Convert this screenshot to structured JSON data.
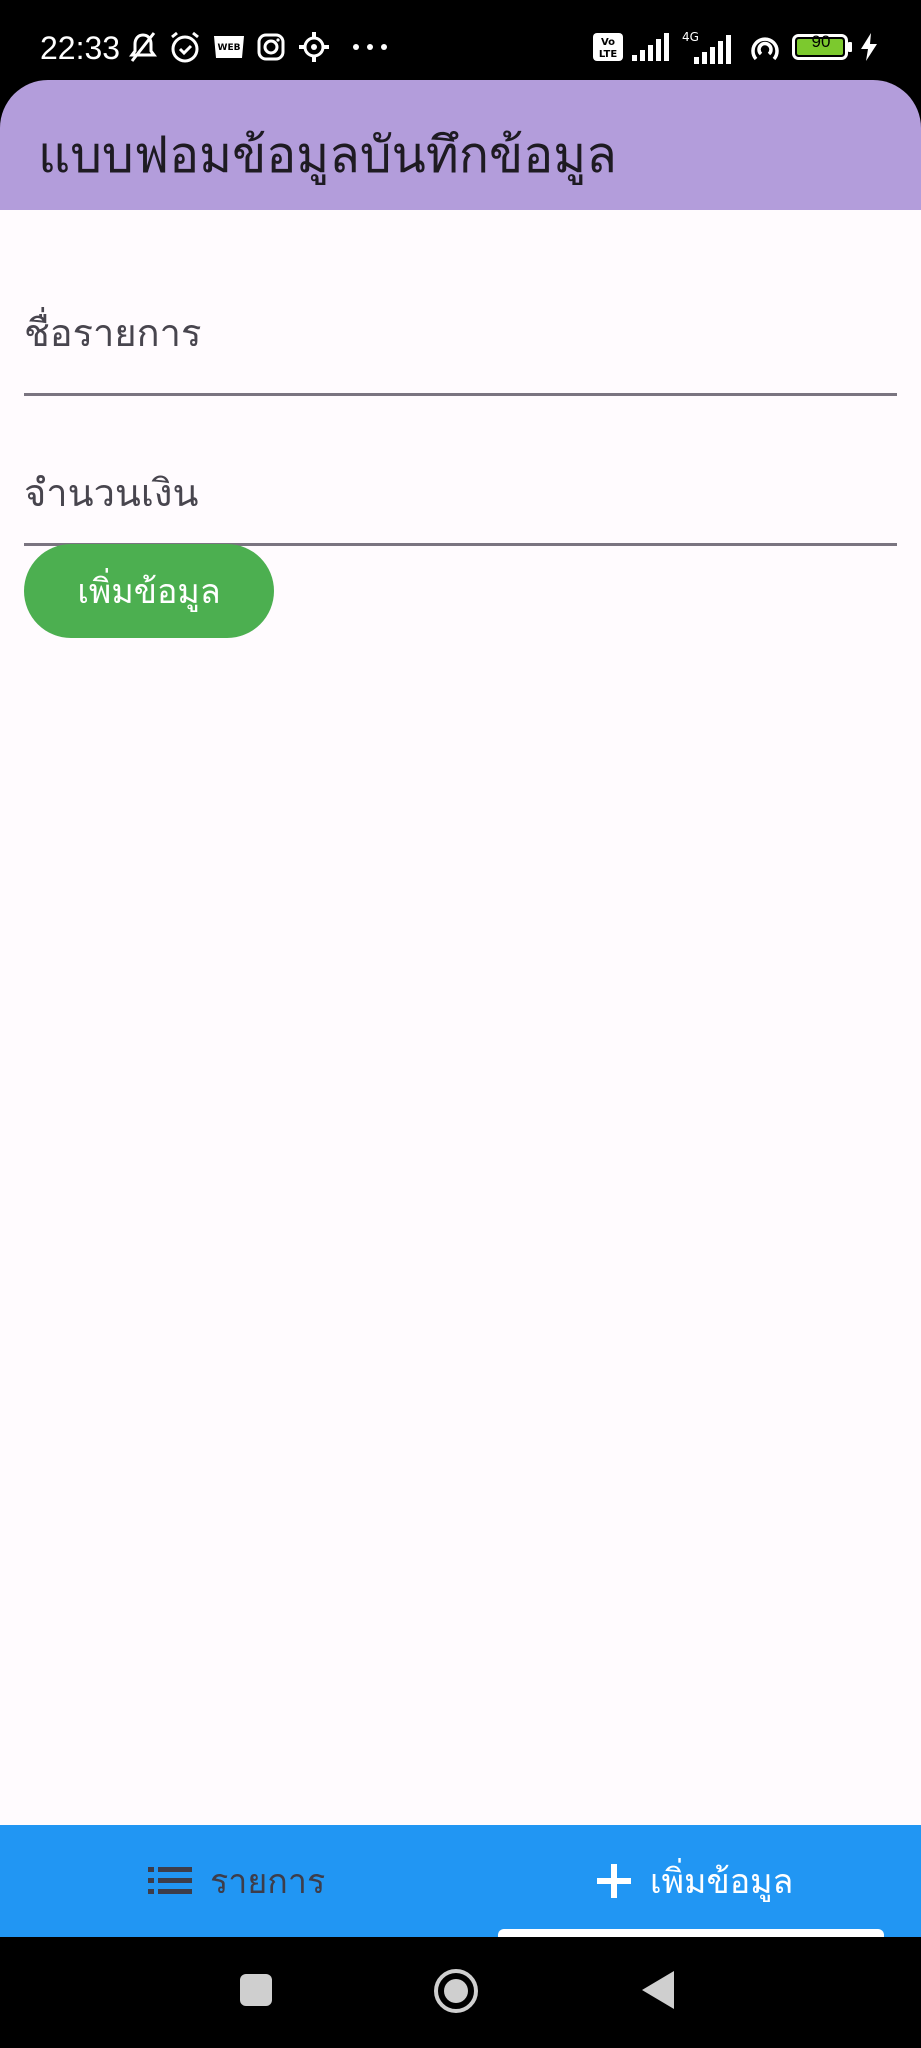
{
  "status_bar": {
    "time": "22:33",
    "battery": "90",
    "network": "4G",
    "volte": "Vo LTE",
    "icons": [
      "bell-off-icon",
      "alarm-icon",
      "webtoon-icon",
      "instagram-icon",
      "gear-icon",
      "more-icon",
      "volte-icon",
      "signal-icon",
      "signal-4g-icon",
      "hotspot-icon",
      "battery-icon",
      "charging-icon"
    ]
  },
  "app_bar": {
    "title": "แบบฟอมข้อมูลบันทึกข้อมูล",
    "color": "#b39ddb"
  },
  "form": {
    "name_label": "ชื่อรายการ",
    "amount_label": "จำนวนเงิน",
    "submit_label": "เพิ่มข้อมูล",
    "submit_color": "#4caf50"
  },
  "bottom_nav": {
    "color": "#2196f3",
    "items": [
      {
        "label": "รายการ",
        "icon": "list-icon",
        "selected": false
      },
      {
        "label": "เพิ่มข้อมูล",
        "icon": "plus-icon",
        "selected": true
      }
    ]
  },
  "system_nav": {
    "icons": [
      "recents-icon",
      "home-icon",
      "back-icon"
    ]
  }
}
